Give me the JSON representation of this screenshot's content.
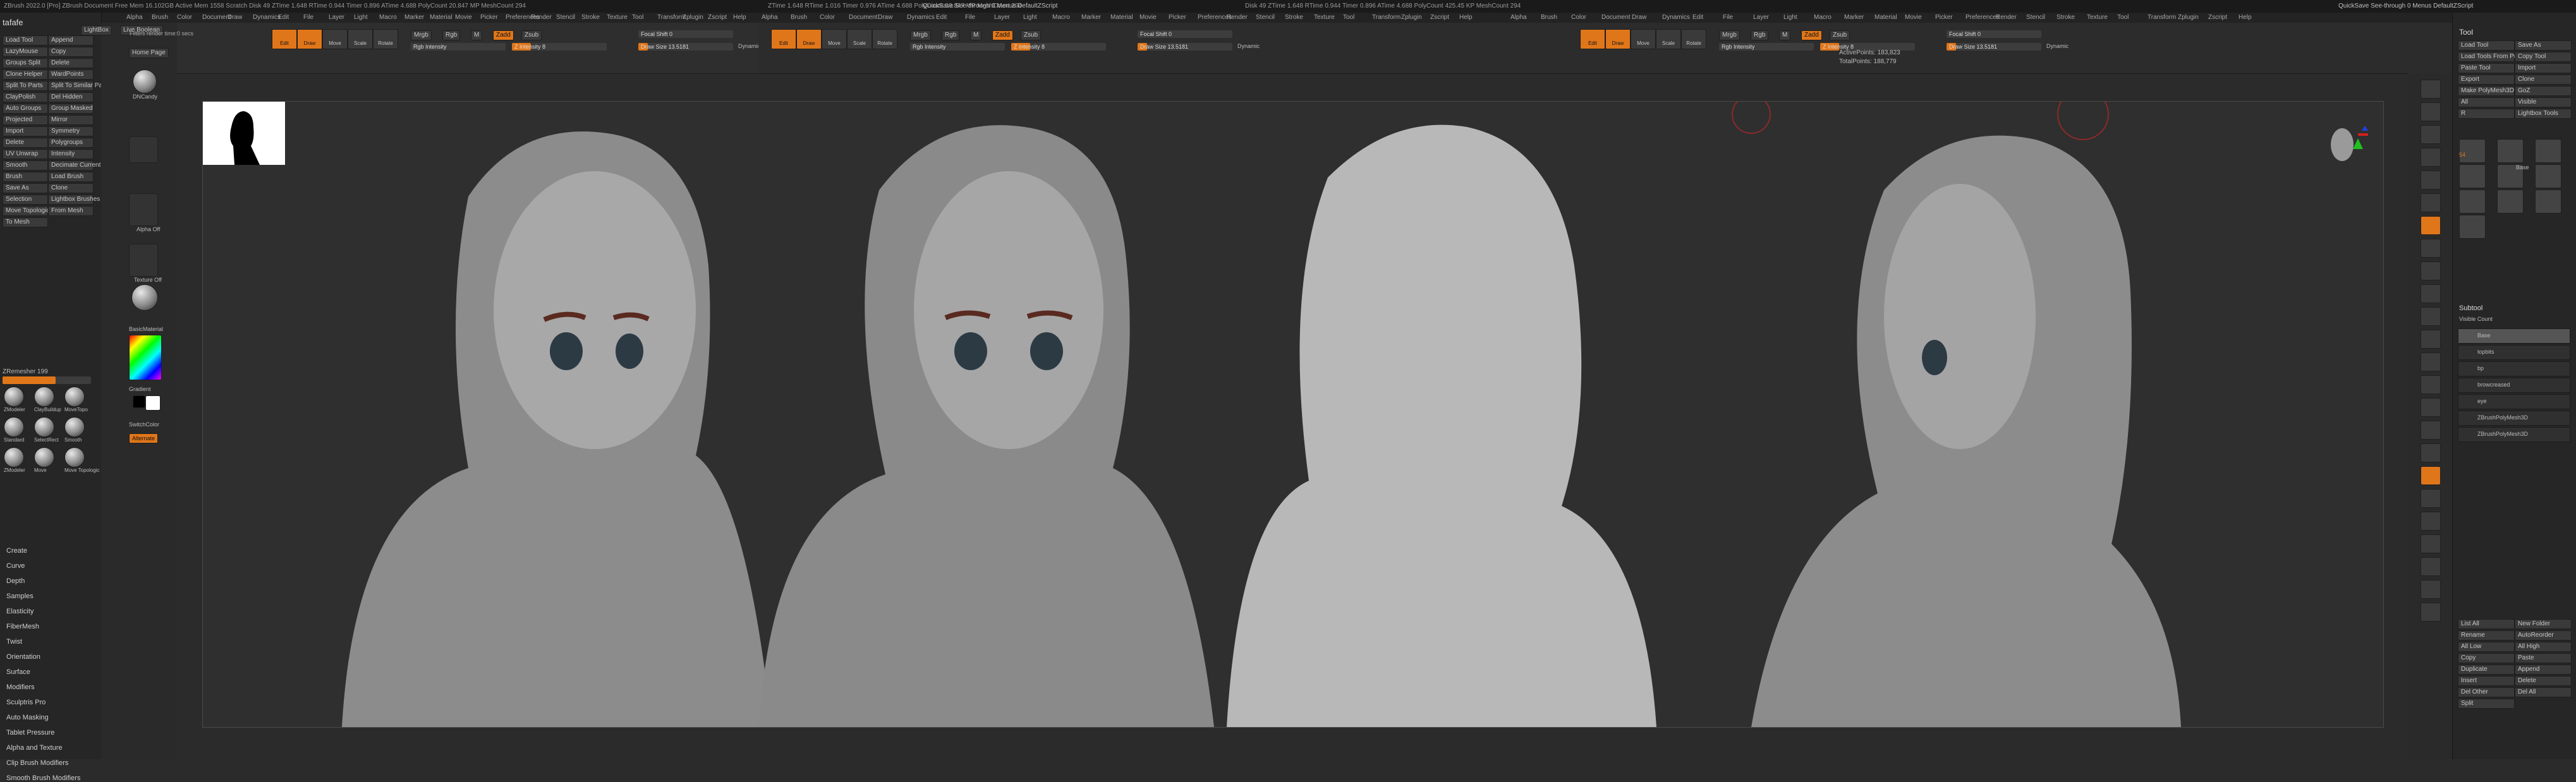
{
  "window": {
    "title_left": "ZBrush 2022.0 [Pro]   ZBrush Document   Free Mem 16.102GB  Active Mem 1558  Scratch Disk 49  ZTime 1.648 RTime 0.944 Timer 0.896 ATime 4.688  PolyCount 20.847 MP  MeshCount 294",
    "title_mid": "QuickSave   See-through 0   Menus   DefaultZScript",
    "title_right": "QuickSave   See-through 0   Menus   DefaultZScript",
    "title_mid2": "ZTime 1.648 RTime 1.016 Timer 0.976 ATime 4.688  PolyCount 20.847 MP  MeshCount 294",
    "title_right2": "Disk 49  ZTime 1.648 RTime 0.944 Timer 0.896 ATime 4.688  PolyCount 425.45 KP  MeshCount 294"
  },
  "menu": [
    "Alpha",
    "Brush",
    "Color",
    "Document",
    "Draw",
    "Dynamics",
    "Edit",
    "File",
    "Layer",
    "Light",
    "Macro",
    "Marker",
    "Material",
    "Movie",
    "Picker",
    "Preferences",
    "Render",
    "Stencil",
    "Stroke",
    "Texture",
    "Tool",
    "Transform",
    "Zplugin",
    "Zscript",
    "Help"
  ],
  "notice": "Filters render time:0 secs",
  "left_panel": {
    "title": "tafafe",
    "buttons": [
      "Load Tool",
      "Append",
      "LazyMouse",
      "Copy",
      "Groups Split",
      "Delete",
      "Clone Helper",
      "WardPoints",
      "Split To Parts",
      "Split To Similar Parts",
      "ClayPolish",
      "Del Hidden",
      "Auto Groups",
      "Group Masked",
      "Projected",
      "Mirror",
      "Import",
      "Symmetry",
      "Delete",
      "Polygroups",
      "UV Unwrap",
      "Intensity",
      "Smooth",
      "Decimate Current",
      "Brush",
      "Load Brush",
      "Save As",
      "Clone",
      "Selection",
      "Lightbox Brushes",
      "Move Topologic",
      "From Mesh",
      "To Mesh"
    ],
    "zremesher_label": "ZRemesher 199",
    "brushes": [
      "ZModeler",
      "ClayBuildup",
      "MoveTopo",
      "Standard",
      "SelectRect",
      "Smooth",
      "ZModeler",
      "Move",
      "Move Topologic"
    ],
    "palettes": [
      "Create",
      "Curve",
      "Depth",
      "Samples",
      "Elasticity",
      "FiberMesh",
      "Twist",
      "Orientation",
      "Surface",
      "Modifiers",
      "Sculptris Pro",
      "Auto Masking",
      "Tablet Pressure",
      "Alpha and Texture",
      "Clip Brush Modifiers",
      "Smooth Brush Modifiers"
    ]
  },
  "shelf": {
    "home_page": "Home Page",
    "lightbox": "LightBox",
    "live_boolean": "Live Boolean",
    "items": [
      "DNCandy",
      "Alpha Off",
      "Texture Off",
      "BasicMaterial",
      "Gradient",
      "SwitchColor",
      "Alternate"
    ]
  },
  "toolbar": {
    "mode_buttons": [
      "Edit",
      "Draw",
      "Move",
      "Scale",
      "Rotate"
    ],
    "mrgb": "Mrgb",
    "rgb": "Rgb",
    "m": "M",
    "zadd": "Zadd",
    "zsub": "Zsub",
    "rgb_intensity": "Rgb Intensity",
    "z_intensity": "Z Intensity 8",
    "focal_shift": "Focal Shift 0",
    "draw_size": "Draw Size 13.5181",
    "dynamic": "Dynamic",
    "active_points": "ActivePoints: 183,823",
    "total_points": "TotalPoints: 188,779"
  },
  "right_panel": {
    "title": "Tool",
    "buttons": [
      "Load Tool",
      "Save As",
      "Load Tools From Project",
      "Copy Tool",
      "Paste Tool",
      "Import",
      "Export",
      "Clone",
      "Make PolyMesh3D",
      "GoZ",
      "All",
      "Visible",
      "R",
      "Lightbox Tools"
    ],
    "tool_name": "Base",
    "tool_count": "54",
    "subtool_title": "Subtool",
    "subtool_label": "Visible Count",
    "subtools": [
      "Base",
      "topbits",
      "bp",
      "browcreased",
      "eye",
      "ZBrushPolyMesh3D",
      "ZBrushPolyMesh3D"
    ],
    "bottom": [
      "List All",
      "New Folder",
      "Rename",
      "AutoReorder",
      "All Low",
      "All High",
      "Copy",
      "Paste",
      "Duplicate",
      "Append",
      "Insert",
      "Delete",
      "Del Other",
      "Del All",
      "Split"
    ]
  },
  "colors": {
    "accent": "#e0761a",
    "panel": "#262626",
    "canvas": "#2f2f2f"
  },
  "icons": [
    "brush-sphere-icon",
    "material-icon",
    "color-picker-icon",
    "head-navigation-icon",
    "axis-gizmo-icon",
    "brush-ring-icon"
  ]
}
